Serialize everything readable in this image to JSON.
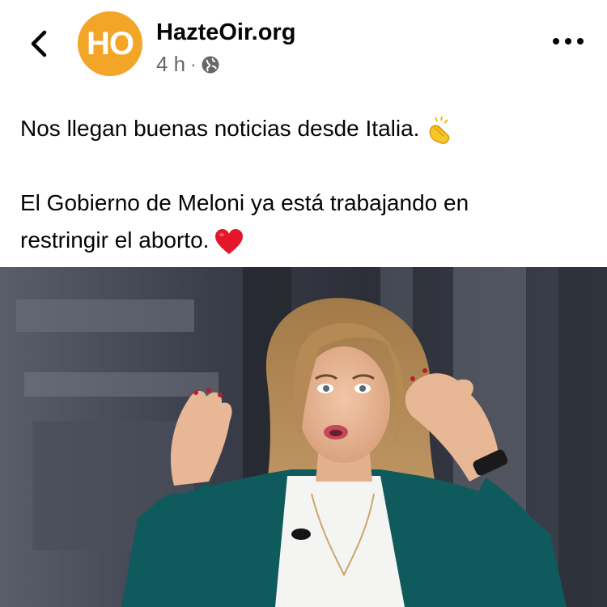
{
  "header": {
    "page_name": "HazteOir.org",
    "avatar_text": "HO",
    "time_ago": "4 h",
    "separator": "·",
    "privacy_icon": "globe-icon",
    "back_icon": "chevron-left-icon",
    "more_icon": "more-horizontal-icon"
  },
  "post": {
    "line1": "Nos llegan buenas noticias desde Italia.",
    "line1_emoji": "clapping-hands-emoji",
    "line2": "El Gobierno de Meloni ya está trabajando en",
    "line3": "restringir el aborto.",
    "line3_emoji": "red-heart-emoji"
  },
  "colors": {
    "avatar_bg": "#f2a526",
    "secondary_text": "#65676b",
    "primary_text": "#050505",
    "jacket": "#0f5a5c"
  }
}
